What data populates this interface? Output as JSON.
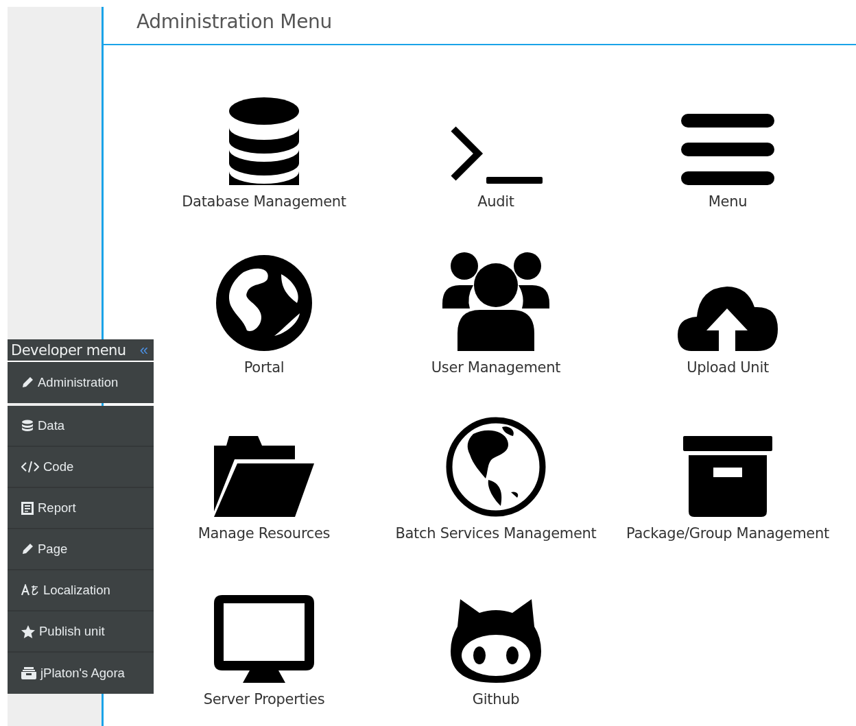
{
  "header": {
    "title": "Administration Menu"
  },
  "tiles": [
    {
      "kind": "database",
      "label": "Database Management"
    },
    {
      "kind": "terminal",
      "label": "Audit"
    },
    {
      "kind": "bars",
      "label": "Menu"
    },
    {
      "kind": "globe",
      "label": "Portal"
    },
    {
      "kind": "users",
      "label": "User Management"
    },
    {
      "kind": "cloud-upload",
      "label": "Upload Unit"
    },
    {
      "kind": "folder",
      "label": "Manage Resources"
    },
    {
      "kind": "globe-ring",
      "label": "Batch Services Management"
    },
    {
      "kind": "archive",
      "label": "Package/Group Management"
    },
    {
      "kind": "monitor",
      "label": "Server Properties"
    },
    {
      "kind": "cat",
      "label": "Github"
    }
  ],
  "developer_menu": {
    "title": "Developer menu",
    "collapse_icon": "«",
    "sections": [
      {
        "items": [
          {
            "kind": "pencil",
            "label": "Administration"
          }
        ]
      },
      {
        "items": [
          {
            "kind": "database",
            "label": "Data"
          },
          {
            "kind": "code",
            "label": "Code"
          },
          {
            "kind": "report",
            "label": "Report"
          },
          {
            "kind": "pencil",
            "label": "Page"
          },
          {
            "kind": "language",
            "label": "Localization"
          },
          {
            "kind": "star",
            "label": "Publish unit"
          },
          {
            "kind": "inbox",
            "label": "jPlaton's Agora"
          }
        ]
      }
    ]
  }
}
